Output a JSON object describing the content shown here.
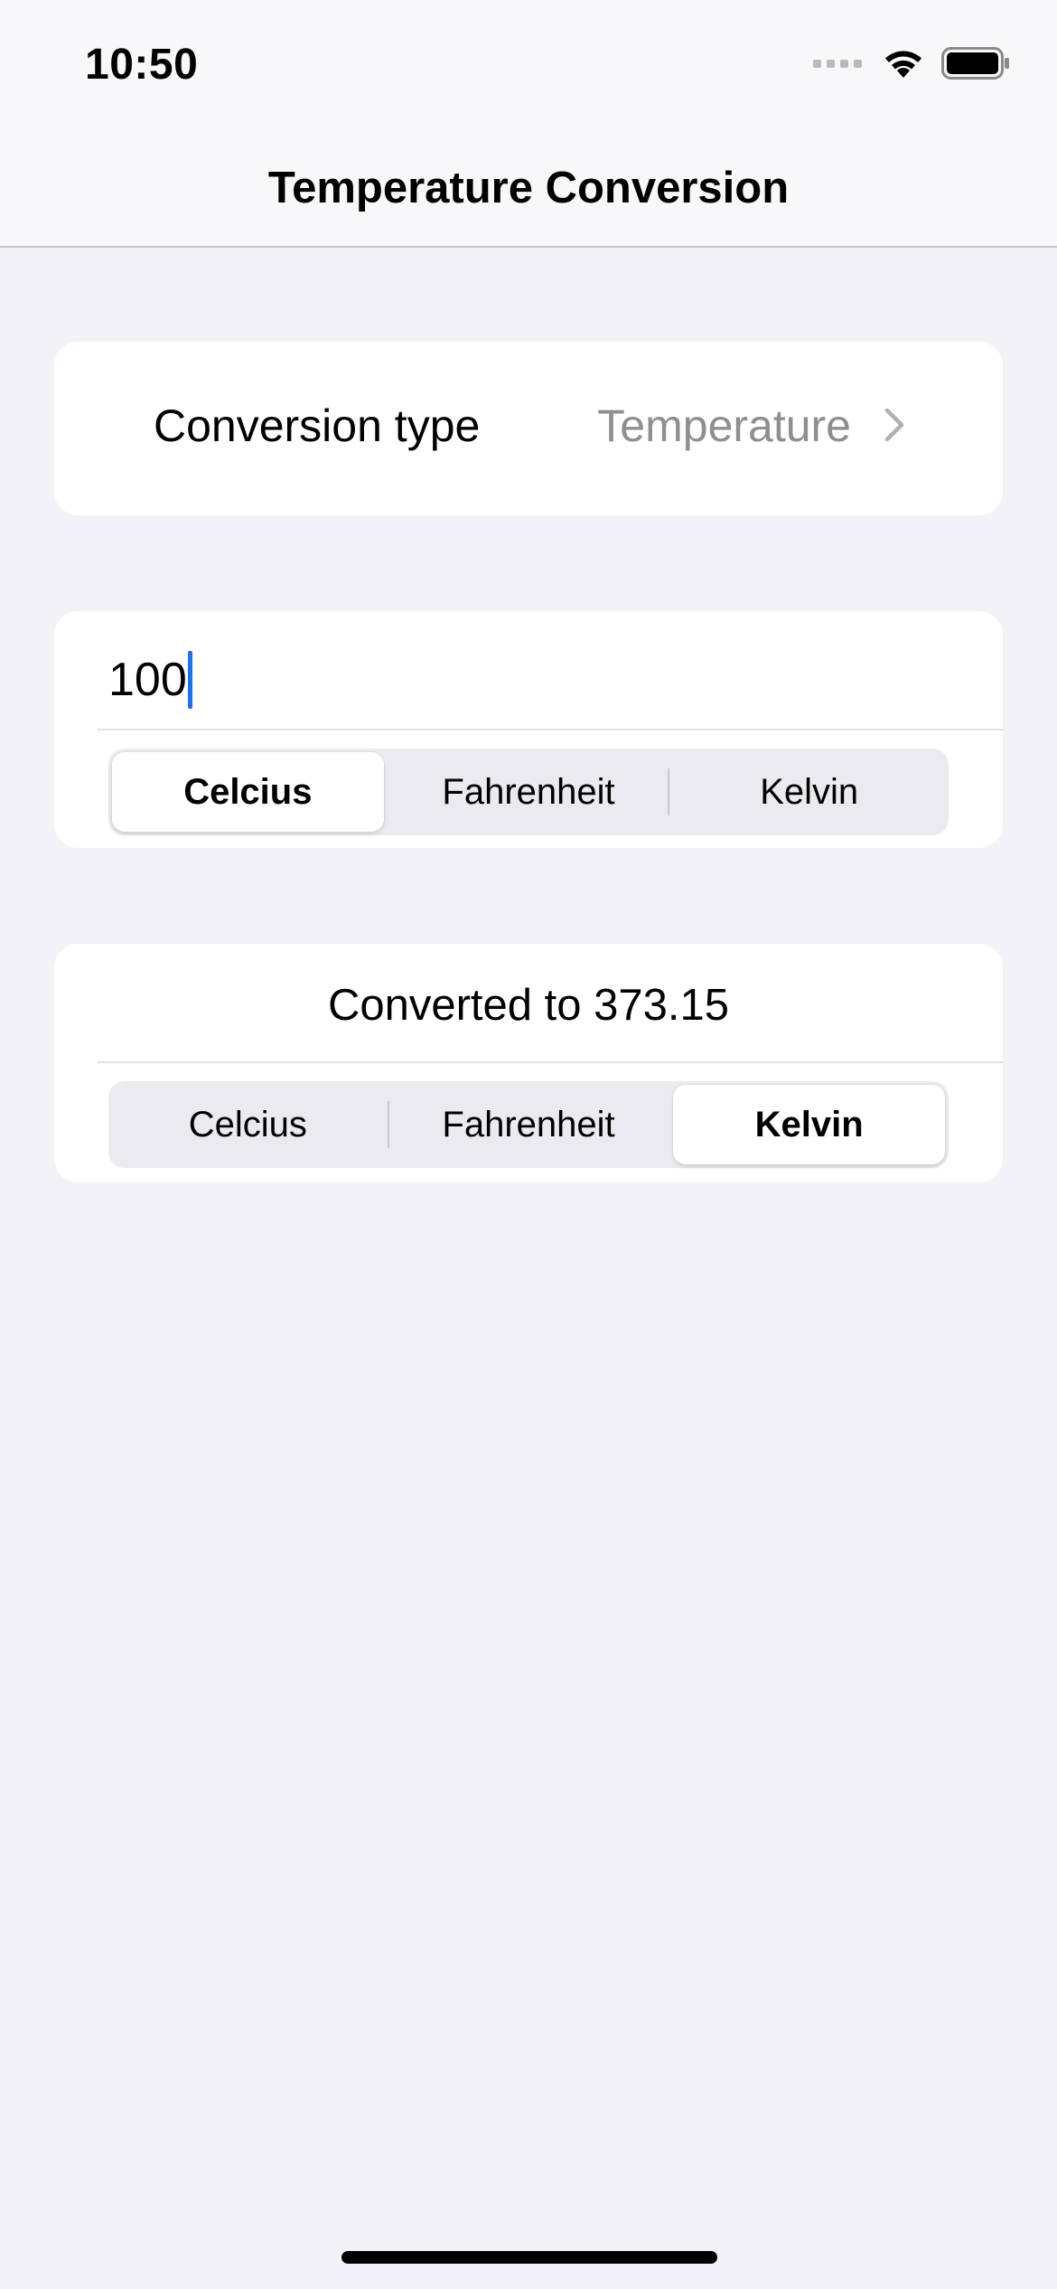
{
  "status_bar": {
    "time": "10:50",
    "icons": [
      "signal-icon",
      "wifi-icon",
      "battery-icon"
    ]
  },
  "nav": {
    "title": "Temperature Conversion"
  },
  "conversion_type": {
    "label": "Conversion type",
    "value": "Temperature",
    "icon": "chevron-right-icon"
  },
  "input": {
    "value": "100",
    "units": {
      "options": [
        "Celcius",
        "Fahrenheit",
        "Kelvin"
      ],
      "selected": "Celcius"
    }
  },
  "output": {
    "text": "Converted to 373.15",
    "units": {
      "options": [
        "Celcius",
        "Fahrenheit",
        "Kelvin"
      ],
      "selected": "Kelvin"
    }
  },
  "colors": {
    "background": "#f2f2f7",
    "card": "#ffffff",
    "secondary_text": "#8e8e93",
    "caret": "#1a73e8"
  }
}
